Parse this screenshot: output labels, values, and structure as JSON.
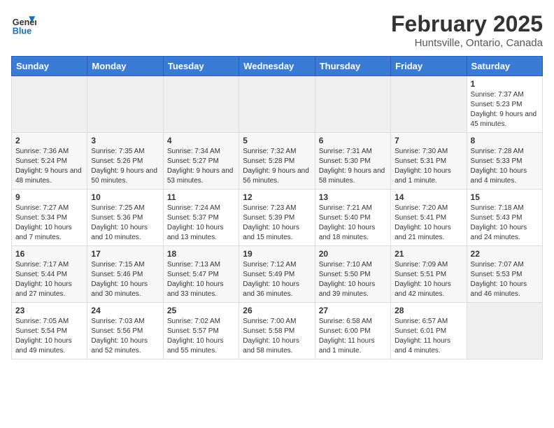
{
  "header": {
    "logo_line1": "General",
    "logo_line2": "Blue",
    "month": "February 2025",
    "location": "Huntsville, Ontario, Canada"
  },
  "days_of_week": [
    "Sunday",
    "Monday",
    "Tuesday",
    "Wednesday",
    "Thursday",
    "Friday",
    "Saturday"
  ],
  "weeks": [
    [
      {
        "day": "",
        "info": ""
      },
      {
        "day": "",
        "info": ""
      },
      {
        "day": "",
        "info": ""
      },
      {
        "day": "",
        "info": ""
      },
      {
        "day": "",
        "info": ""
      },
      {
        "day": "",
        "info": ""
      },
      {
        "day": "1",
        "info": "Sunrise: 7:37 AM\nSunset: 5:23 PM\nDaylight: 9 hours and 45 minutes."
      }
    ],
    [
      {
        "day": "2",
        "info": "Sunrise: 7:36 AM\nSunset: 5:24 PM\nDaylight: 9 hours and 48 minutes."
      },
      {
        "day": "3",
        "info": "Sunrise: 7:35 AM\nSunset: 5:26 PM\nDaylight: 9 hours and 50 minutes."
      },
      {
        "day": "4",
        "info": "Sunrise: 7:34 AM\nSunset: 5:27 PM\nDaylight: 9 hours and 53 minutes."
      },
      {
        "day": "5",
        "info": "Sunrise: 7:32 AM\nSunset: 5:28 PM\nDaylight: 9 hours and 56 minutes."
      },
      {
        "day": "6",
        "info": "Sunrise: 7:31 AM\nSunset: 5:30 PM\nDaylight: 9 hours and 58 minutes."
      },
      {
        "day": "7",
        "info": "Sunrise: 7:30 AM\nSunset: 5:31 PM\nDaylight: 10 hours and 1 minute."
      },
      {
        "day": "8",
        "info": "Sunrise: 7:28 AM\nSunset: 5:33 PM\nDaylight: 10 hours and 4 minutes."
      }
    ],
    [
      {
        "day": "9",
        "info": "Sunrise: 7:27 AM\nSunset: 5:34 PM\nDaylight: 10 hours and 7 minutes."
      },
      {
        "day": "10",
        "info": "Sunrise: 7:25 AM\nSunset: 5:36 PM\nDaylight: 10 hours and 10 minutes."
      },
      {
        "day": "11",
        "info": "Sunrise: 7:24 AM\nSunset: 5:37 PM\nDaylight: 10 hours and 13 minutes."
      },
      {
        "day": "12",
        "info": "Sunrise: 7:23 AM\nSunset: 5:39 PM\nDaylight: 10 hours and 15 minutes."
      },
      {
        "day": "13",
        "info": "Sunrise: 7:21 AM\nSunset: 5:40 PM\nDaylight: 10 hours and 18 minutes."
      },
      {
        "day": "14",
        "info": "Sunrise: 7:20 AM\nSunset: 5:41 PM\nDaylight: 10 hours and 21 minutes."
      },
      {
        "day": "15",
        "info": "Sunrise: 7:18 AM\nSunset: 5:43 PM\nDaylight: 10 hours and 24 minutes."
      }
    ],
    [
      {
        "day": "16",
        "info": "Sunrise: 7:17 AM\nSunset: 5:44 PM\nDaylight: 10 hours and 27 minutes."
      },
      {
        "day": "17",
        "info": "Sunrise: 7:15 AM\nSunset: 5:46 PM\nDaylight: 10 hours and 30 minutes."
      },
      {
        "day": "18",
        "info": "Sunrise: 7:13 AM\nSunset: 5:47 PM\nDaylight: 10 hours and 33 minutes."
      },
      {
        "day": "19",
        "info": "Sunrise: 7:12 AM\nSunset: 5:49 PM\nDaylight: 10 hours and 36 minutes."
      },
      {
        "day": "20",
        "info": "Sunrise: 7:10 AM\nSunset: 5:50 PM\nDaylight: 10 hours and 39 minutes."
      },
      {
        "day": "21",
        "info": "Sunrise: 7:09 AM\nSunset: 5:51 PM\nDaylight: 10 hours and 42 minutes."
      },
      {
        "day": "22",
        "info": "Sunrise: 7:07 AM\nSunset: 5:53 PM\nDaylight: 10 hours and 46 minutes."
      }
    ],
    [
      {
        "day": "23",
        "info": "Sunrise: 7:05 AM\nSunset: 5:54 PM\nDaylight: 10 hours and 49 minutes."
      },
      {
        "day": "24",
        "info": "Sunrise: 7:03 AM\nSunset: 5:56 PM\nDaylight: 10 hours and 52 minutes."
      },
      {
        "day": "25",
        "info": "Sunrise: 7:02 AM\nSunset: 5:57 PM\nDaylight: 10 hours and 55 minutes."
      },
      {
        "day": "26",
        "info": "Sunrise: 7:00 AM\nSunset: 5:58 PM\nDaylight: 10 hours and 58 minutes."
      },
      {
        "day": "27",
        "info": "Sunrise: 6:58 AM\nSunset: 6:00 PM\nDaylight: 11 hours and 1 minute."
      },
      {
        "day": "28",
        "info": "Sunrise: 6:57 AM\nSunset: 6:01 PM\nDaylight: 11 hours and 4 minutes."
      },
      {
        "day": "",
        "info": ""
      }
    ]
  ]
}
